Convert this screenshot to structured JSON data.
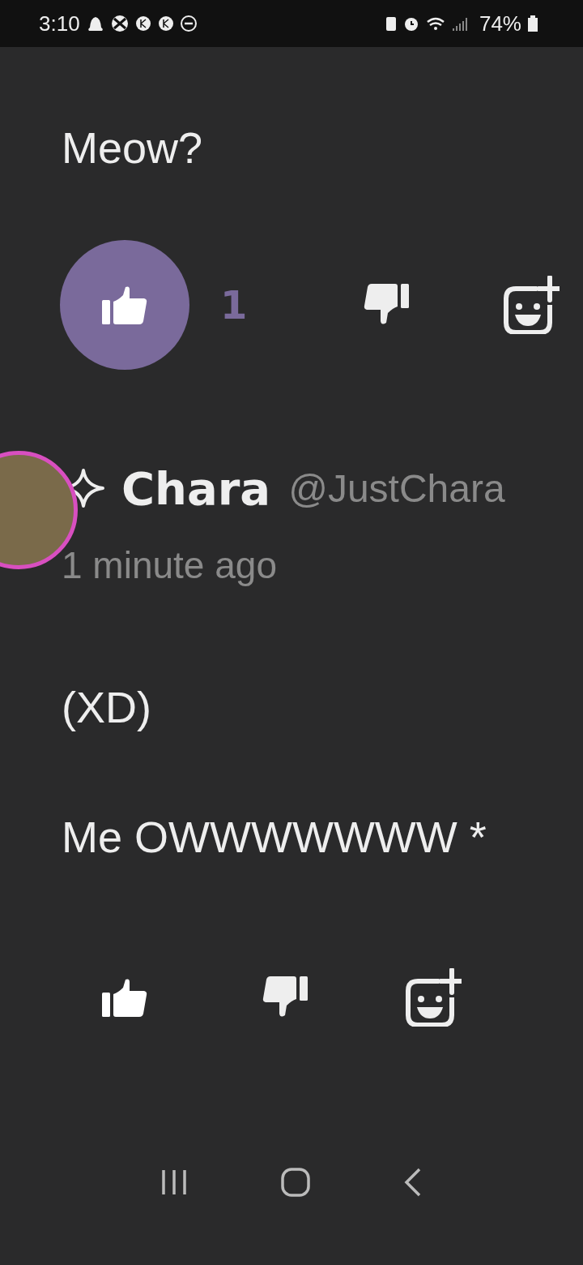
{
  "status_bar": {
    "time": "3:10",
    "battery": "74%"
  },
  "comments": [
    {
      "paragraphs": [
        "Meow?"
      ],
      "liked": true,
      "like_count": "1"
    },
    {
      "author": {
        "name": "Chara",
        "handle": "@JustChara",
        "time": "1 minute ago"
      },
      "paragraphs": [
        "(XD)",
        "Me OWWWWWWW *"
      ],
      "liked": false
    }
  ]
}
